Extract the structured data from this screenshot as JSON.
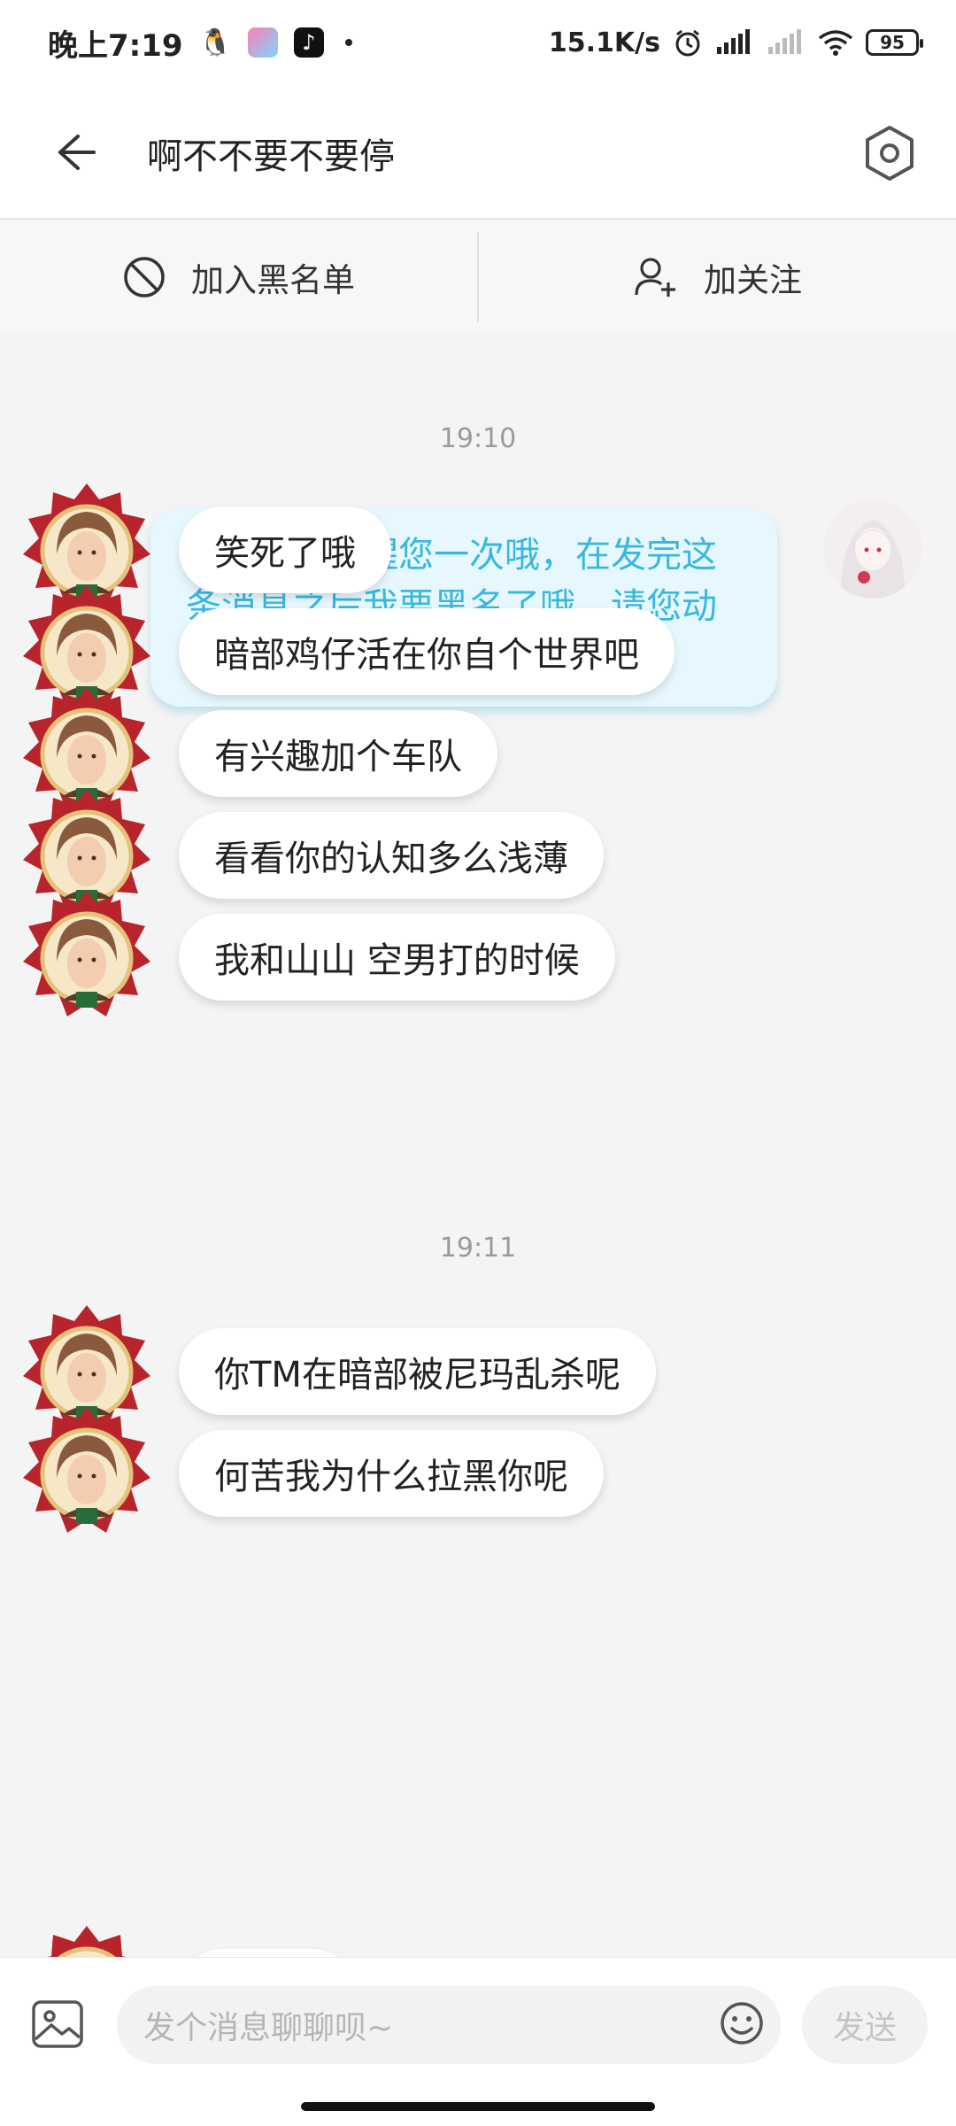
{
  "status_bar": {
    "time": "晚上7:19",
    "network_speed": "15.1K/s",
    "battery": "95"
  },
  "header": {
    "title": "啊不不要不要停"
  },
  "actions": {
    "block_label": "加入黑名单",
    "follow_label": "加关注"
  },
  "chat": {
    "timestamp_1": "19:10",
    "my_message": "这边最后提醒您一次哦，在发完这条消息之后我要黑名了哦，请您动动手指互黑哦",
    "messages_1": [
      "笑死了哦",
      "暗部鸡仔活在你自个世界吧",
      "有兴趣加个车队",
      "看看你的认知多么浅薄",
      "我和山山 空男打的时候"
    ],
    "timestamp_2": "19:11",
    "messages_2": [
      "你TM在暗部被尼玛乱杀呢",
      "何苦我为什么拉黑你呢"
    ]
  },
  "input": {
    "placeholder": "发个消息聊聊呗~",
    "send_label": "发送"
  },
  "colors": {
    "my_bubble_bg": "#e6f8fe",
    "my_bubble_text": "#38b7e0"
  }
}
